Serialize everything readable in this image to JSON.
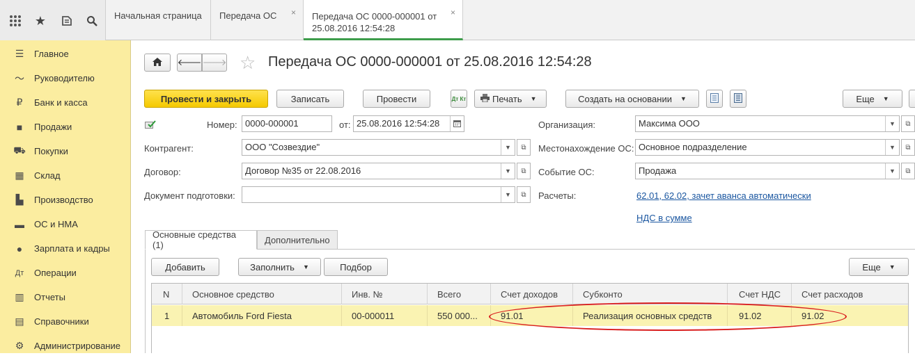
{
  "topbar": {
    "icons": [
      "apps-grid-icon",
      "star-icon",
      "history-icon",
      "search-icon"
    ],
    "tabs": [
      {
        "label": "Начальная страница"
      },
      {
        "label": "Передача ОС",
        "close": "×"
      },
      {
        "label": "Передача ОС 0000-000001 от 25.08.2016 12:54:28",
        "close": "×"
      }
    ]
  },
  "sidebar": {
    "items": [
      {
        "label": "Главное",
        "icon": "menu-icon"
      },
      {
        "label": "Руководителю",
        "icon": "trend-icon"
      },
      {
        "label": "Банк и касса",
        "icon": "ruble-icon"
      },
      {
        "label": "Продажи",
        "icon": "bag-icon"
      },
      {
        "label": "Покупки",
        "icon": "cart-icon"
      },
      {
        "label": "Склад",
        "icon": "warehouse-icon"
      },
      {
        "label": "Производство",
        "icon": "factory-icon"
      },
      {
        "label": "ОС и НМА",
        "icon": "truck-icon"
      },
      {
        "label": "Зарплата и кадры",
        "icon": "person-icon"
      },
      {
        "label": "Операции",
        "icon": "dt-kt-icon"
      },
      {
        "label": "Отчеты",
        "icon": "bar-chart-icon"
      },
      {
        "label": "Справочники",
        "icon": "book-icon"
      },
      {
        "label": "Администрирование",
        "icon": "gear-icon"
      }
    ]
  },
  "doc": {
    "title": "Передача ОС 0000-000001 от 25.08.2016 12:54:28",
    "toolbar": {
      "post_close": "Провести и закрыть",
      "save": "Записать",
      "post": "Провести",
      "dtkt": "Дт Кт",
      "print": "Печать",
      "create_based": "Создать на основании",
      "more": "Еще"
    },
    "fields": {
      "number_label": "Номер:",
      "number_value": "0000-000001",
      "date_label": "от:",
      "date_value": "25.08.2016 12:54:28",
      "org_label": "Организация:",
      "org_value": "Максима ООО",
      "counterparty_label": "Контрагент:",
      "counterparty_value": "ООО \"Созвездие\"",
      "location_label": "Местонахождение ОС:",
      "location_value": "Основное подразделение",
      "contract_label": "Договор:",
      "contract_value": "Договор №35 от 22.08.2016",
      "event_label": "Событие ОС:",
      "event_value": "Продажа",
      "prep_doc_label": "Документ подготовки:",
      "prep_doc_value": "",
      "settlements_label": "Расчеты:",
      "settlements_link": "62.01, 62.02, зачет аванса автоматически",
      "vat_link": "НДС в сумме"
    },
    "tabs": [
      {
        "label": "Основные средства (1)"
      },
      {
        "label": "Дополнительно"
      }
    ],
    "table_toolbar": {
      "add": "Добавить",
      "fill": "Заполнить",
      "select": "Подбор",
      "more": "Еще"
    },
    "table": {
      "columns": [
        "N",
        "Основное средство",
        "Инв. №",
        "Всего",
        "Счет доходов",
        "Субконто",
        "Счет НДС",
        "Счет расходов"
      ],
      "rows": [
        [
          "1",
          "Автомобиль Ford Fiesta",
          "00-000011",
          "550 000...",
          "91.01",
          "Реализация основных средств",
          "91.02",
          "91.02"
        ]
      ]
    },
    "highlight_color": "#d91e1e"
  }
}
